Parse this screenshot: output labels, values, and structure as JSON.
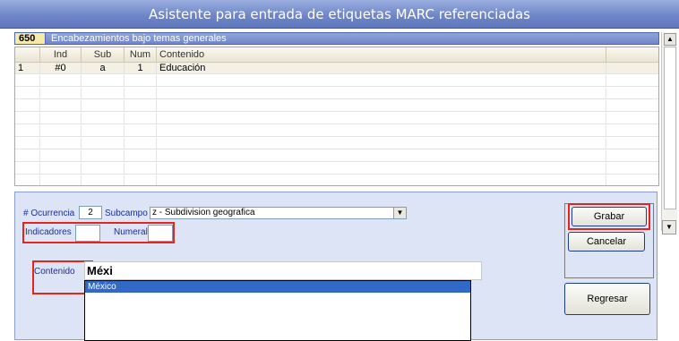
{
  "window": {
    "title": "Asistente para entrada de etiquetas MARC referenciadas"
  },
  "field": {
    "tag": "650",
    "description": "Encabezamientos bajo temas generales"
  },
  "grid": {
    "columns": [
      "",
      "Ind",
      "Sub",
      "Num",
      "Contenido"
    ],
    "rows": [
      {
        "n": "1",
        "ind": "#0",
        "sub": "a",
        "num": "1",
        "contenido": "Educación"
      }
    ]
  },
  "form": {
    "ocurrencia_label": "# Ocurrencia",
    "ocurrencia_value": "2",
    "subcampo_label": "Subcampo",
    "subcampo_value": "z - Subdivision geografica",
    "indicadores_label": "Indicadores",
    "indicadores_value": "",
    "numeral_label": "Numeral",
    "numeral_value": "",
    "contenido_label": "Contenido",
    "contenido_value": "Méxi",
    "suggestions": [
      "México"
    ]
  },
  "buttons": {
    "grabar": "Grabar",
    "cancelar": "Cancelar",
    "regresar": "Regresar"
  },
  "colors": {
    "title_bar": "#6f87c9",
    "highlight": "#e3251b",
    "selection": "#3169c6",
    "panel": "#dde4f6"
  }
}
